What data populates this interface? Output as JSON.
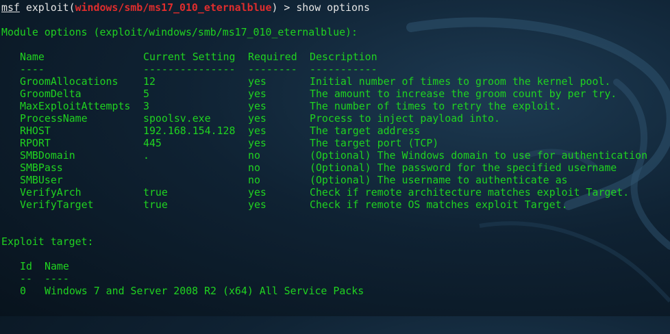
{
  "prompt": {
    "msf": "msf",
    "cmd_prefix": " exploit(",
    "module": "windows/smb/ms17_010_eternalblue",
    "cmd_suffix": ") > show options"
  },
  "module_options_heading": "Module options (exploit/windows/smb/ms17_010_eternalblue):",
  "options_table": {
    "headers": [
      "Name",
      "Current Setting",
      "Required",
      "Description"
    ],
    "separators": [
      "----",
      "---------------",
      "--------",
      "-----------"
    ],
    "rows": [
      [
        "GroomAllocations",
        "12",
        "yes",
        "Initial number of times to groom the kernel pool."
      ],
      [
        "GroomDelta",
        "5",
        "yes",
        "The amount to increase the groom count by per try."
      ],
      [
        "MaxExploitAttempts",
        "3",
        "yes",
        "The number of times to retry the exploit."
      ],
      [
        "ProcessName",
        "spoolsv.exe",
        "yes",
        "Process to inject payload into."
      ],
      [
        "RHOST",
        "192.168.154.128",
        "yes",
        "The target address"
      ],
      [
        "RPORT",
        "445",
        "yes",
        "The target port (TCP)"
      ],
      [
        "SMBDomain",
        ".",
        "no",
        "(Optional) The Windows domain to use for authentication"
      ],
      [
        "SMBPass",
        "",
        "no",
        "(Optional) The password for the specified username"
      ],
      [
        "SMBUser",
        "",
        "no",
        "(Optional) The username to authenticate as"
      ],
      [
        "VerifyArch",
        "true",
        "yes",
        "Check if remote architecture matches exploit Target."
      ],
      [
        "VerifyTarget",
        "true",
        "yes",
        "Check if remote OS matches exploit Target."
      ]
    ]
  },
  "exploit_target_heading": "Exploit target:",
  "target_table": {
    "headers": [
      "Id",
      "Name"
    ],
    "separators": [
      "--",
      "----"
    ],
    "rows": [
      [
        "0",
        "Windows 7 and Server 2008 R2 (x64) All Service Packs"
      ]
    ]
  },
  "colors": {
    "terminal_green": "#20d320",
    "prompt_white": "#e6e6e6",
    "module_red": "#e02d2d",
    "background": "#0f2233"
  },
  "icons": {
    "background_art": "kali-dragon-watermark"
  }
}
